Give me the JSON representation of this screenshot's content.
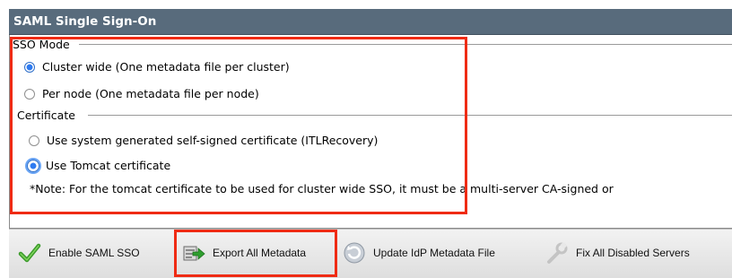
{
  "header": {
    "title": "SAML Single Sign-On"
  },
  "sso_mode": {
    "legend": "SSO Mode",
    "options": [
      {
        "label": "Cluster wide (One metadata file per cluster)",
        "checked": true
      },
      {
        "label": "Per node (One metadata file per node)",
        "checked": false
      }
    ]
  },
  "certificate": {
    "legend": "Certificate",
    "options": [
      {
        "label": "Use system generated self-signed certificate (ITLRecovery)",
        "checked": false
      },
      {
        "label": "Use Tomcat certificate",
        "checked": true
      }
    ],
    "note": "*Note: For the tomcat certificate to be used for cluster wide SSO, it must be a multi-server CA-signed or"
  },
  "toolbar": {
    "enable_label": "Enable SAML SSO",
    "export_label": "Export All Metadata",
    "update_label": "Update IdP Metadata File",
    "fix_label": "Fix All Disabled Servers"
  },
  "icons": {
    "enable": "checkmark-icon",
    "export": "export-metadata-icon",
    "update": "refresh-icon",
    "fix": "wrench-icon"
  },
  "colors": {
    "header": "#586b7c",
    "highlight": "#ef2b14",
    "radio_selected": "#2f7bf0"
  }
}
